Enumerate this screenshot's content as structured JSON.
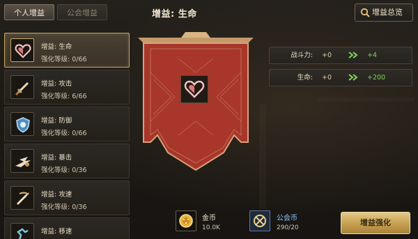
{
  "tabs": {
    "personal": "个人增益",
    "guild": "公会增益"
  },
  "header": {
    "title": "增益: 生命"
  },
  "overview_button": {
    "label": "增益总览"
  },
  "buffs": [
    {
      "name": "增益: 生命",
      "level": "强化等级: 0/66",
      "icon": "heart-icon"
    },
    {
      "name": "增益: 攻击",
      "level": "强化等级: 6/66",
      "icon": "sword-icon"
    },
    {
      "name": "增益: 防御",
      "level": "强化等级: 0/66",
      "icon": "shield-icon"
    },
    {
      "name": "增益: 暴击",
      "level": "强化等级: 0/36",
      "icon": "crit-icon"
    },
    {
      "name": "增益: 攻速",
      "level": "强化等级: 0/36",
      "icon": "attack-speed-icon"
    },
    {
      "name": "增益: 移速",
      "level": "",
      "icon": "move-speed-icon"
    }
  ],
  "stats": [
    {
      "label": "战斗力:",
      "current": "+0",
      "bonus": "+4"
    },
    {
      "label": "生命:",
      "current": "+0",
      "bonus": "+200"
    }
  ],
  "currencies": {
    "gold": {
      "name": "金币",
      "value": "10.0K"
    },
    "guild": {
      "name": "公会币",
      "value": "290/20"
    }
  },
  "enhance_button": {
    "label": "增益强化"
  },
  "colors": {
    "accent_gold": "#c8a663",
    "bonus_green": "#7fd65a",
    "banner_red": "#a8362a",
    "guild_blue": "#8cc4ff"
  }
}
